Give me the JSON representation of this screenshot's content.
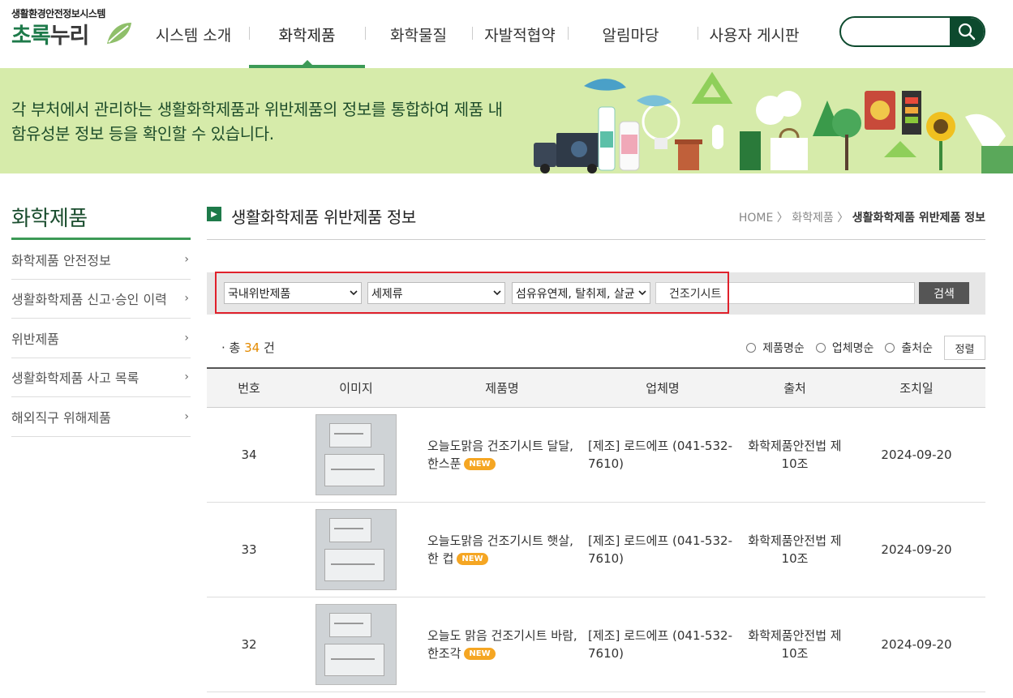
{
  "header": {
    "logo_sub": "생활환경안전정보시스템",
    "logo_main_a": "초록",
    "logo_main_b": "누리",
    "nav": [
      {
        "label": "시스템 소개"
      },
      {
        "label": "화학제품"
      },
      {
        "label": "화학물질"
      },
      {
        "label": "자발적협약"
      },
      {
        "label": "알림마당"
      },
      {
        "label": "사용자 게시판"
      }
    ],
    "active_nav": "화학제품",
    "search_value": ""
  },
  "banner": {
    "line1": "각 부처에서 관리하는 생활화학제품과 위반제품의 정보를 통합하여 제품 내",
    "line2": "함유성분 정보 등을 확인할 수 있습니다."
  },
  "sidebar": {
    "title": "화학제품",
    "items": [
      {
        "label": "화학제품 안전정보"
      },
      {
        "label": "생활화학제품 신고·승인 이력"
      },
      {
        "label": "위반제품"
      },
      {
        "label": "생활화학제품 사고 목록"
      },
      {
        "label": "해외직구 위해제품"
      }
    ]
  },
  "main": {
    "title": "생활화학제품 위반제품 정보",
    "breadcrumb": {
      "home": "HOME",
      "sep": "〉",
      "level1": "화학제품",
      "current": "생활화학제품 위반제품 정보"
    },
    "filters": {
      "type": "국내위반제품",
      "category": "세제류",
      "subcategory": "섬유유연제, 탈취제, 살균",
      "keyword": "건조기시트",
      "search_label": "검색"
    },
    "total": {
      "prefix": "· 총",
      "count": "34",
      "suffix": "건"
    },
    "sort_options": [
      "제품명순",
      "업체명순",
      "출처순"
    ],
    "sort_button": "정렬",
    "columns": [
      "번호",
      "이미지",
      "제품명",
      "업체명",
      "출처",
      "조치일"
    ],
    "rows": [
      {
        "no": "34",
        "name": "오늘도맑음 건조기시트 달달, 한스푼",
        "badge": "NEW",
        "company": "[제조] 로드에프 (041-532-7610)",
        "source": "화학제품안전법 제 10조",
        "date": "2024-09-20"
      },
      {
        "no": "33",
        "name": "오늘도맑음 건조기시트 햇살, 한 컵",
        "badge": "NEW",
        "company": "[제조] 로드에프 (041-532-7610)",
        "source": "화학제품안전법 제 10조",
        "date": "2024-09-20"
      },
      {
        "no": "32",
        "name": "오늘도 맑음 건조기시트 바람, 한조각",
        "badge": "NEW",
        "company": "[제조] 로드에프 (041-532-7610)",
        "source": "화학제품안전법 제 10조",
        "date": "2024-09-20"
      }
    ]
  },
  "colors": {
    "brand_green": "#1e7a4a",
    "accent_green": "#3c9a56",
    "banner_bg": "#d6ebaa",
    "dark_green": "#0d4a2e",
    "badge_orange": "#f5a623",
    "highlight_red": "#e0212b"
  }
}
